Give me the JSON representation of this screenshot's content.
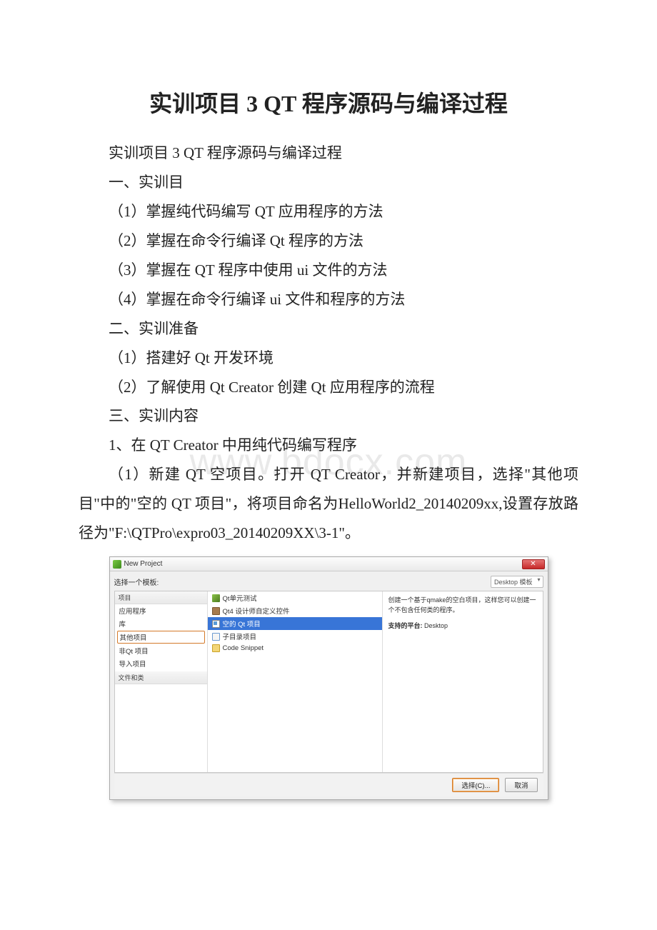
{
  "title": "实训项目 3 QT 程序源码与编译过程",
  "subtitle": "实训项目 3 QT 程序源码与编译过程",
  "section1": {
    "heading": "一、实训目",
    "items": [
      "（1）掌握纯代码编写 QT 应用程序的方法",
      "（2）掌握在命令行编译 Qt 程序的方法",
      "（3）掌握在 QT 程序中使用 ui 文件的方法",
      "（4）掌握在命令行编译 ui 文件和程序的方法"
    ]
  },
  "section2": {
    "heading": "二、实训准备",
    "items": [
      "（1）搭建好 Qt 开发环境",
      "（2）了解使用 Qt Creator 创建 Qt 应用程序的流程"
    ]
  },
  "section3": {
    "heading": "三、实训内容",
    "step1": "1、在 QT Creator 中用纯代码编写程序",
    "desc": "（1）新建 QT 空项目。打开 QT Creator，并新建项目，选择\"其他项目\"中的\"空的 QT 项目\"，将项目命名为HelloWorld2_20140209xx,设置存放路径为\"F:\\QTPro\\expro03_20140209XX\\3-1\"。"
  },
  "watermark": "www.bdocx.com",
  "dialog": {
    "title": "New Project",
    "label": "选择一个模板:",
    "dropdown": "Desktop 模板",
    "left": {
      "header": "项目",
      "items": [
        "应用程序",
        "库",
        "其他项目",
        "非Qt 项目",
        "导入项目"
      ],
      "footer": "文件和类",
      "selectedIndex": 2
    },
    "mid": {
      "items": [
        {
          "icon": "green",
          "label": "Qt单元测试"
        },
        {
          "icon": "brown",
          "label": "Qt4 设计师自定义控件"
        },
        {
          "icon": "form",
          "label": "空的 Qt 项目"
        },
        {
          "icon": "blue",
          "label": "子目录项目"
        },
        {
          "icon": "folder",
          "label": "Code Snippet"
        }
      ],
      "selectedIndex": 2
    },
    "right": {
      "desc": "创建一个基于qmake的空白项目，这样您可以创建一个不包含任何类的程序。",
      "platformLabel": "支持的平台:",
      "platformValue": "Desktop"
    },
    "buttons": {
      "choose": "选择(C)...",
      "cancel": "取消"
    }
  }
}
